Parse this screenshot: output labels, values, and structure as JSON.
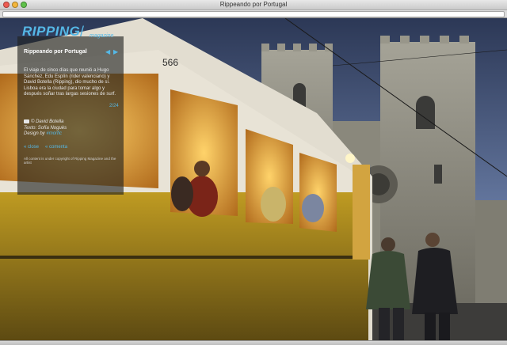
{
  "window": {
    "title": "Rippeando por Portugal"
  },
  "magazine": {
    "brand": "RIPPING",
    "brand_sub": "magazine"
  },
  "article": {
    "title": "Rippeando por Portugal",
    "intro": "El viaje de cinco días que reunió a Hugo Sánchez, Edu Esplín (rider valenciano) y David Botella (Ripping), dio mucho de sí. Lisboa era la ciudad para tomar algo y después soñar tras largas sesiones de surf.",
    "pager": "2/24",
    "photo_credit": "© David Botella",
    "text_credit": "Texto: Sofía Noguès",
    "design_label": "Design by",
    "design_link": "#morfic",
    "actions": {
      "close": "« close",
      "comment": "« comenta"
    },
    "copyright": "All content is under copyright of Ripping Magazine and the artist"
  },
  "colors": {
    "accent": "#55b8e6",
    "tram_yellow": "#c7a020"
  },
  "icons": {
    "prev": "chevron-left-icon",
    "next": "chevron-right-icon",
    "camera": "camera-icon"
  }
}
